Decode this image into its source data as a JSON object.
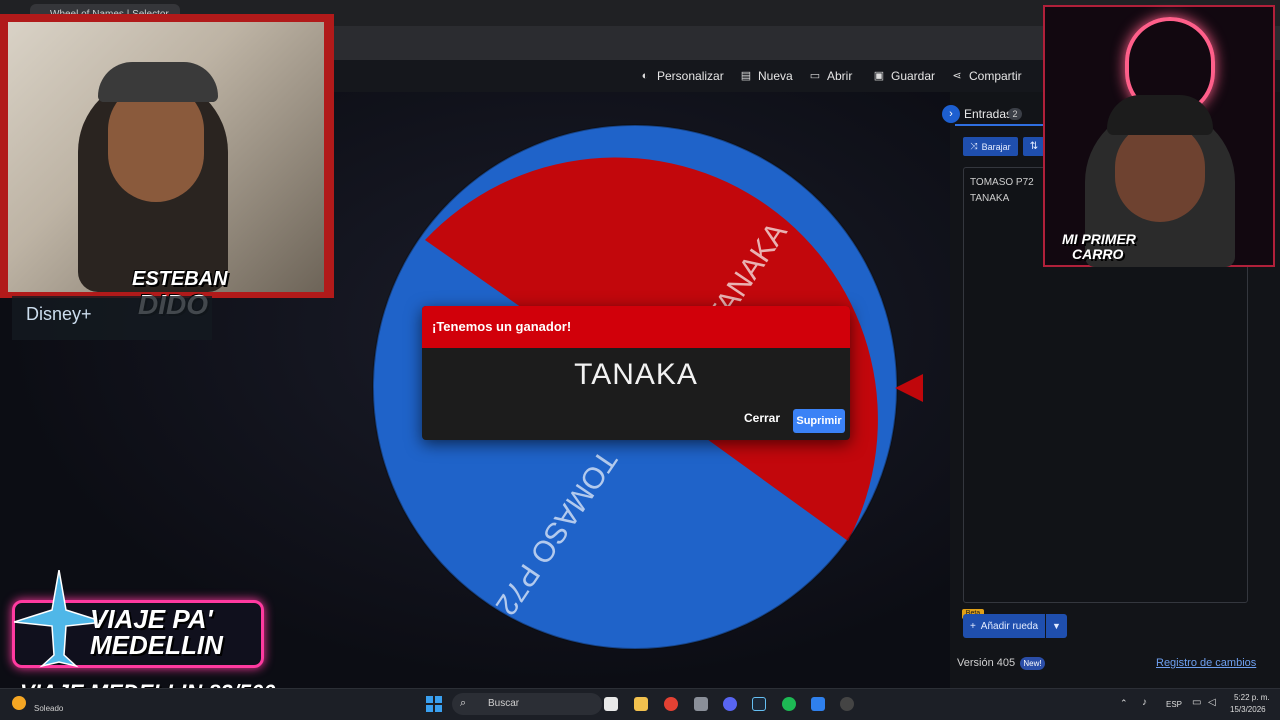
{
  "browser": {
    "tab_title": "Wheel of Names | Selector"
  },
  "header": {
    "nav": [
      {
        "label": "Personalizar",
        "icon": "palette-icon"
      },
      {
        "label": "Nueva",
        "icon": "file-icon"
      },
      {
        "label": "Abrir",
        "icon": "folder-open-icon"
      },
      {
        "label": "Guardar",
        "icon": "save-icon"
      },
      {
        "label": "Compartir",
        "icon": "share-icon"
      }
    ]
  },
  "wheel": {
    "segments": [
      {
        "label": "TANAKA",
        "color": "#c2070c"
      },
      {
        "label": "TOMASO P72",
        "color": "#1f63c9"
      }
    ]
  },
  "dialog": {
    "title": "¡Tenemos un ganador!",
    "winner": "TANAKA",
    "close_label": "Cerrar",
    "remove_label": "Suprimir"
  },
  "sidebar": {
    "title": "Entradas",
    "count": "2",
    "shuffle_label": "Barajar",
    "entries": [
      "TOMASO P72",
      "TANAKA"
    ],
    "beta_badge": "Beta",
    "add_wheel_label": "Añadir rueda",
    "version": "Versión 405",
    "new_badge": "New!",
    "changelog_label": "Registro de cambios"
  },
  "overlays": {
    "cam1_name_line1": "ESTEBAN",
    "cam1_name_line2": "DIDO",
    "cam2_name_line1": "MI PRIMER",
    "cam2_name_line2": "CARRO",
    "disney": "Disney+",
    "badge_line1": "VIAJE PA'",
    "badge_line2": "MEDELLIN",
    "counter": "VIAJE MEDELLIN 82/500"
  },
  "taskbar": {
    "weather": "Soleado",
    "search_placeholder": "Buscar",
    "language": "ESP",
    "time": "5:22 p. m.",
    "date": "15/3/2026"
  },
  "colors": {
    "accent_red": "#d1000a",
    "accent_blue": "#3b82f6"
  }
}
